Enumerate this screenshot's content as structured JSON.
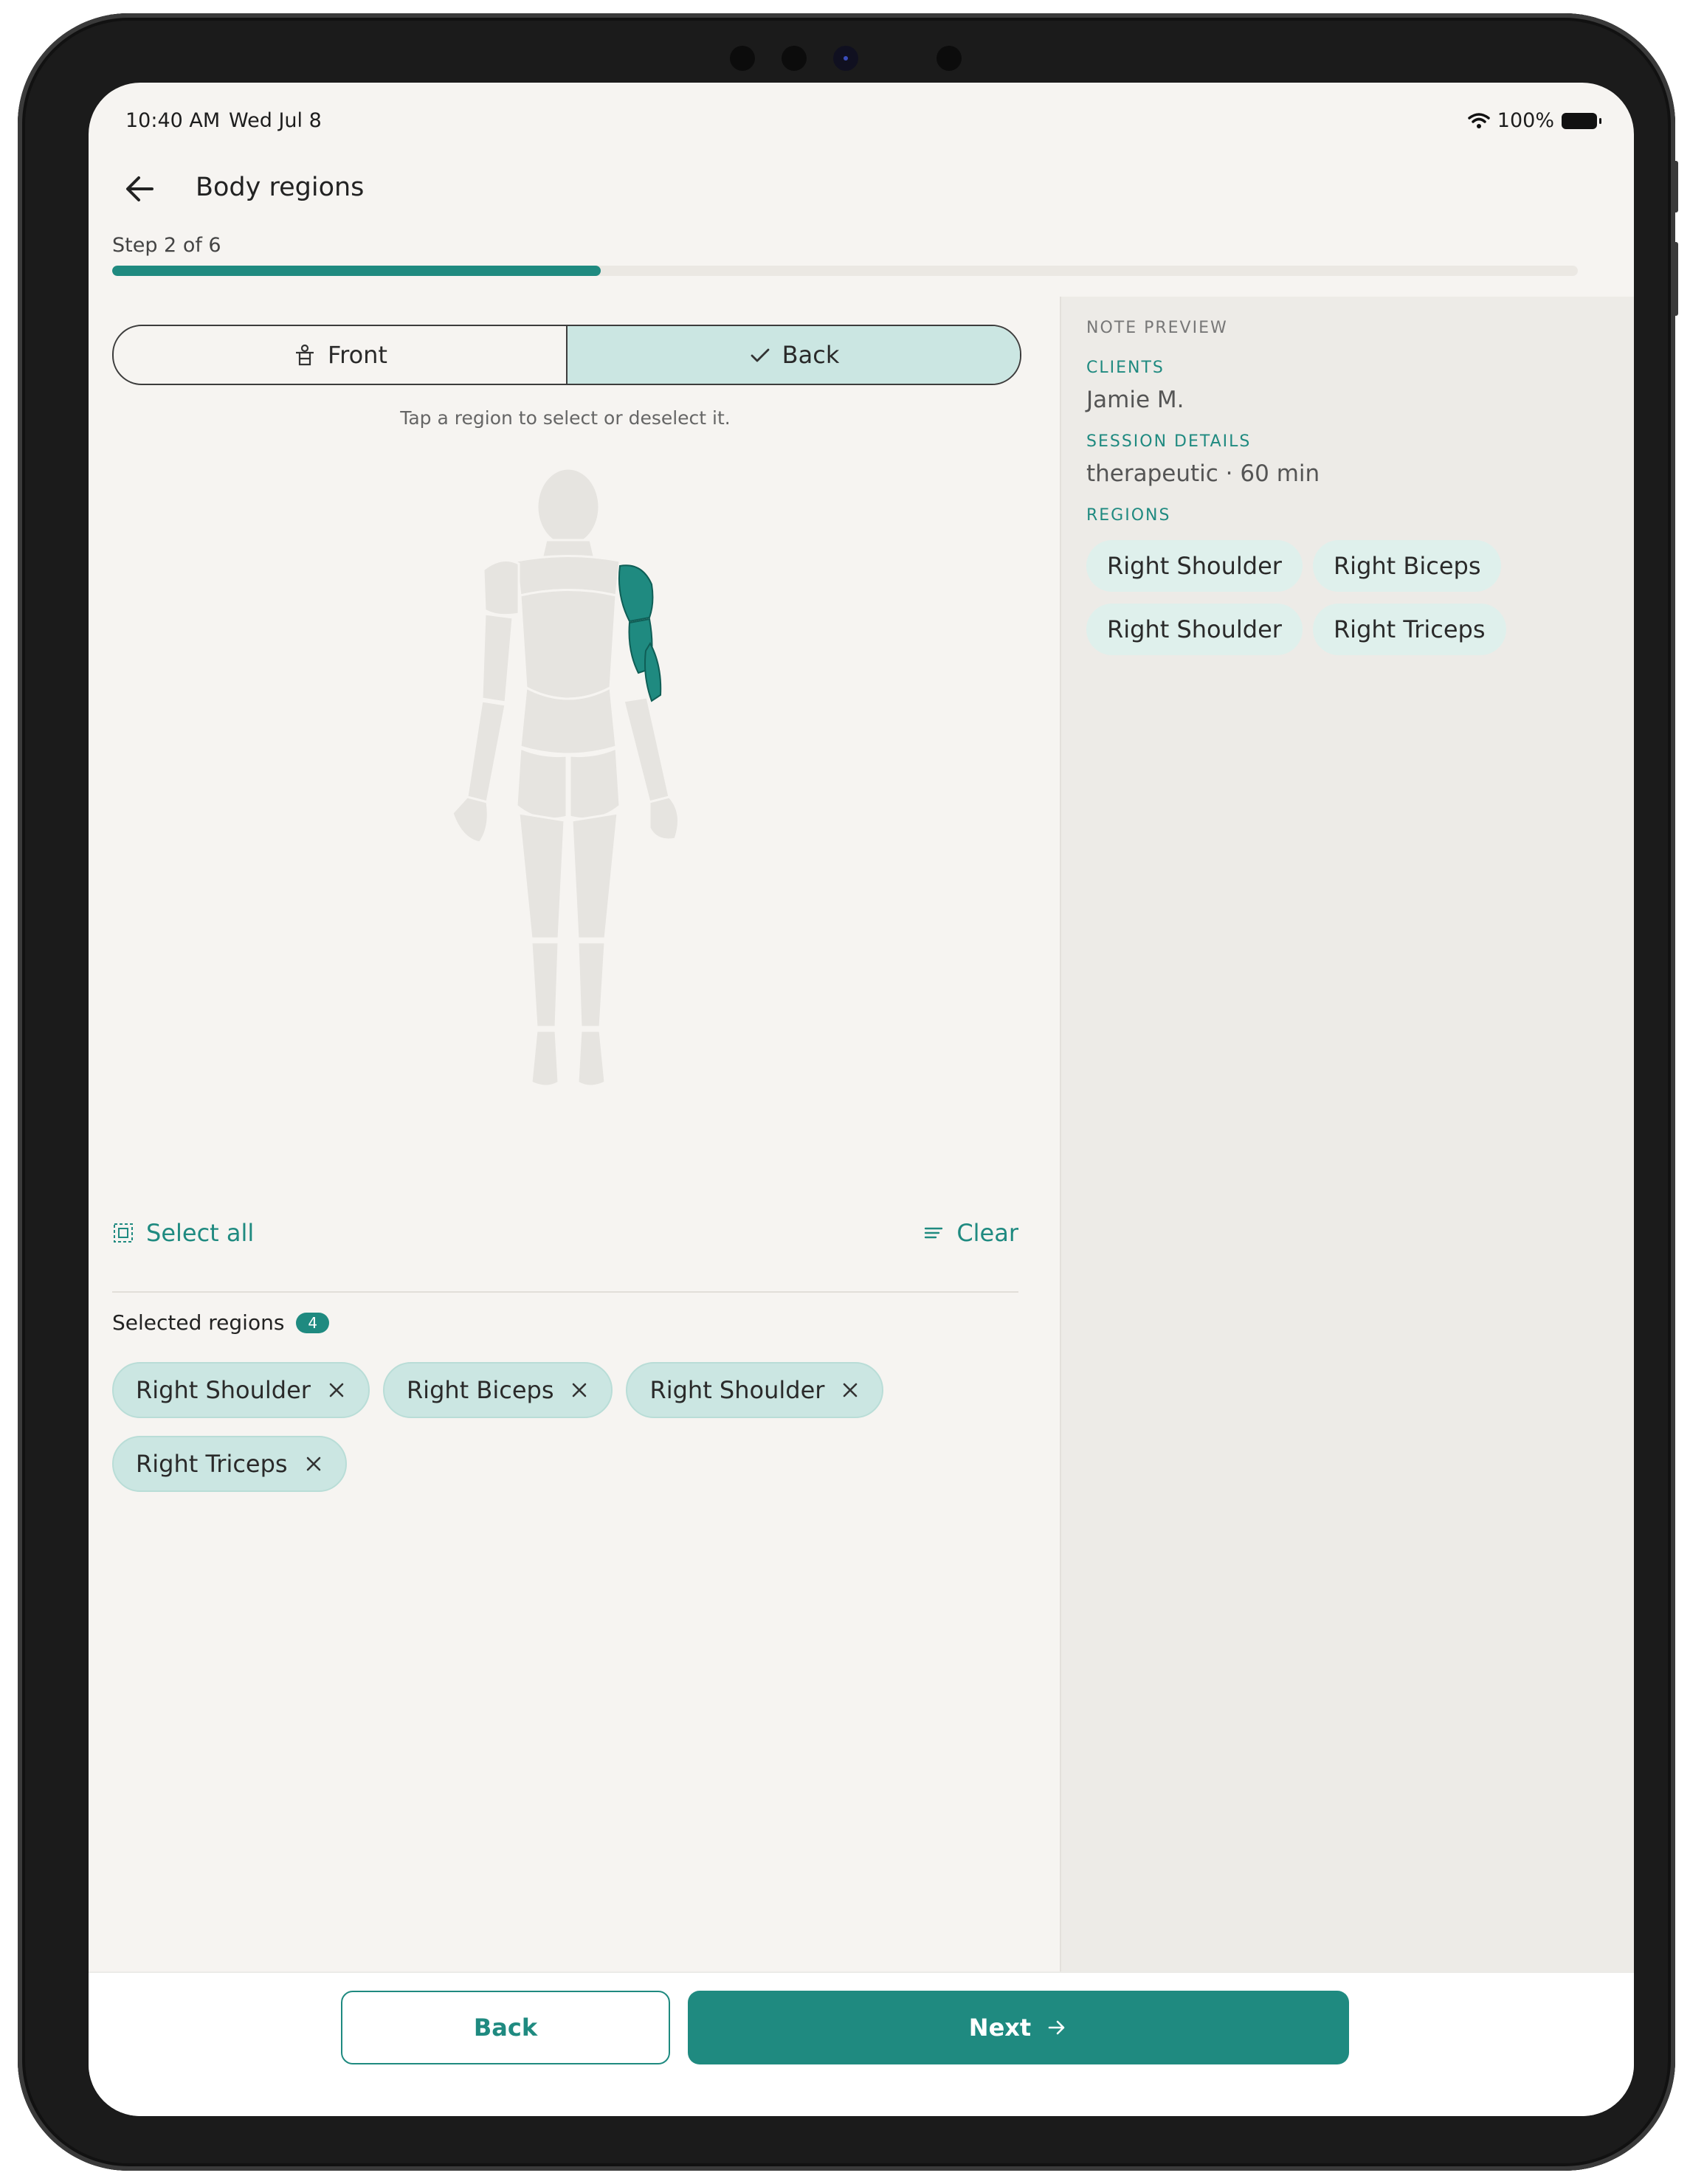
{
  "status_bar": {
    "time": "10:40 AM",
    "date": "Wed Jul 8",
    "battery": "100%"
  },
  "header": {
    "title": "Body regions"
  },
  "progress": {
    "label": "Step 2 of 6",
    "current": 2,
    "total": 6
  },
  "view_toggle": {
    "front_label": "Front",
    "back_label": "Back",
    "selected": "back"
  },
  "hint": "Tap a region to select or deselect it.",
  "actions": {
    "select_all": "Select all",
    "clear": "Clear"
  },
  "selected": {
    "title": "Selected regions",
    "count": "4",
    "items": [
      "Right Shoulder",
      "Right Biceps",
      "Right Shoulder",
      "Right Triceps"
    ]
  },
  "note_preview": {
    "title": "NOTE PREVIEW",
    "clients_label": "CLIENTS",
    "client": "Jamie M.",
    "session_label": "SESSION DETAILS",
    "session": "therapeutic · 60 min",
    "regions_label": "REGIONS",
    "regions": [
      "Right Shoulder",
      "Right Biceps",
      "Right Shoulder",
      "Right Triceps"
    ]
  },
  "footer": {
    "back_label": "Back",
    "next_label": "Next"
  },
  "colors": {
    "accent": "#1f8a80",
    "chip_bg": "#cbe6e2",
    "panel_bg": "#edebe7"
  }
}
